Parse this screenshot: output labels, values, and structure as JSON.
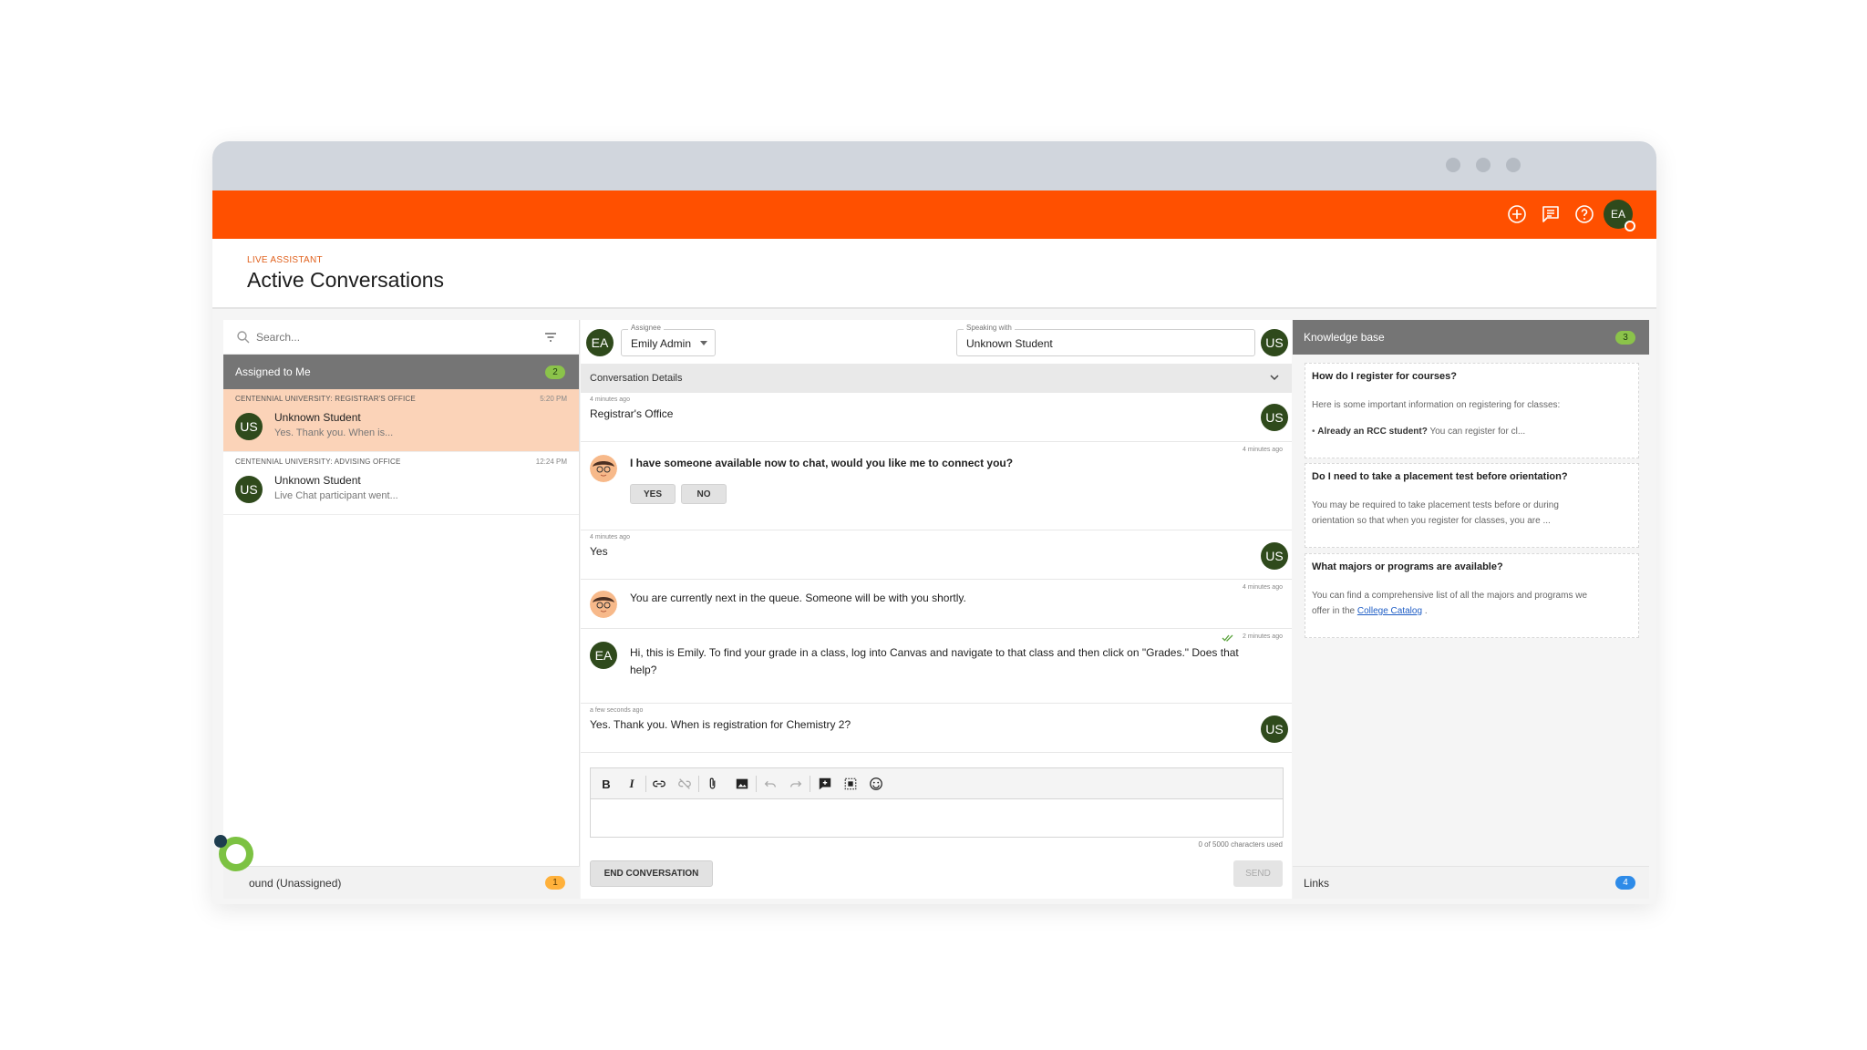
{
  "header": {
    "eyebrow": "LIVE ASSISTANT",
    "title": "Active Conversations",
    "user_initials": "EA",
    "accent_color": "#ff5000",
    "icons": [
      "plus-circle-icon",
      "chat-icon",
      "help-icon"
    ]
  },
  "sidebar": {
    "search_placeholder": "Search...",
    "group_label": "Assigned to Me",
    "group_count": "2",
    "conversations": [
      {
        "org": "CENTENNIAL UNIVERSITY: REGISTRAR'S OFFICE",
        "time": "5:20 PM",
        "initials": "US",
        "name": "Unknown Student",
        "preview": "Yes. Thank you. When is..."
      },
      {
        "org": "CENTENNIAL UNIVERSITY: ADVISING OFFICE",
        "time": "12:24 PM",
        "initials": "US",
        "name": "Unknown Student",
        "preview": "Live Chat participant went..."
      }
    ],
    "footer_label": "ound (Unassigned)",
    "footer_count": "1"
  },
  "conversation": {
    "agent_initials": "EA",
    "assignee_label": "Assignee",
    "assignee_value": "Emily Admin",
    "speaking_label": "Speaking with",
    "speaking_value": "Unknown Student",
    "student_initials": "US",
    "details_label": "Conversation Details",
    "messages": [
      {
        "time": "4 minutes ago",
        "text": "Registrar's Office"
      },
      {
        "time": "4 minutes ago",
        "text": "I have someone available now to chat, would you like me to connect you?",
        "yes": "YES",
        "no": "NO"
      },
      {
        "time": "4 minutes ago",
        "text": "Yes"
      },
      {
        "time": "4 minutes ago",
        "text": "You are currently next in the queue. Someone will be with you shortly."
      },
      {
        "time": "2 minutes ago",
        "text": "Hi, this is Emily. To find your grade in a class, log into Canvas and navigate to that class and then click on \"Grades.\" Does that help?"
      },
      {
        "time": "a few seconds ago",
        "text": "Yes. Thank you. When is registration for Chemistry 2?"
      }
    ],
    "char_count": "0 of 5000 characters used",
    "end_label": "END CONVERSATION",
    "send_label": "SEND"
  },
  "knowledge": {
    "title": "Knowledge base",
    "count": "3",
    "cards": [
      {
        "question": "How do I register for courses?",
        "line1": "Here is some important information on registering for classes:",
        "bullet_bold": "Already an RCC student?",
        "bullet_rest": "You can register for cl..."
      },
      {
        "question": "Do I need to take a placement test before orientation?",
        "line1": "You may be required to take placement tests before or during",
        "line2": "orientation so that when you register for classes, you are ..."
      },
      {
        "question": "What majors or programs are available?",
        "line1": "You can find a comprehensive list of all the majors and programs we",
        "line2_pre": "offer in the",
        "link": "College Catalog",
        "line2_post": "."
      }
    ],
    "links_label": "Links",
    "links_count": "4"
  }
}
